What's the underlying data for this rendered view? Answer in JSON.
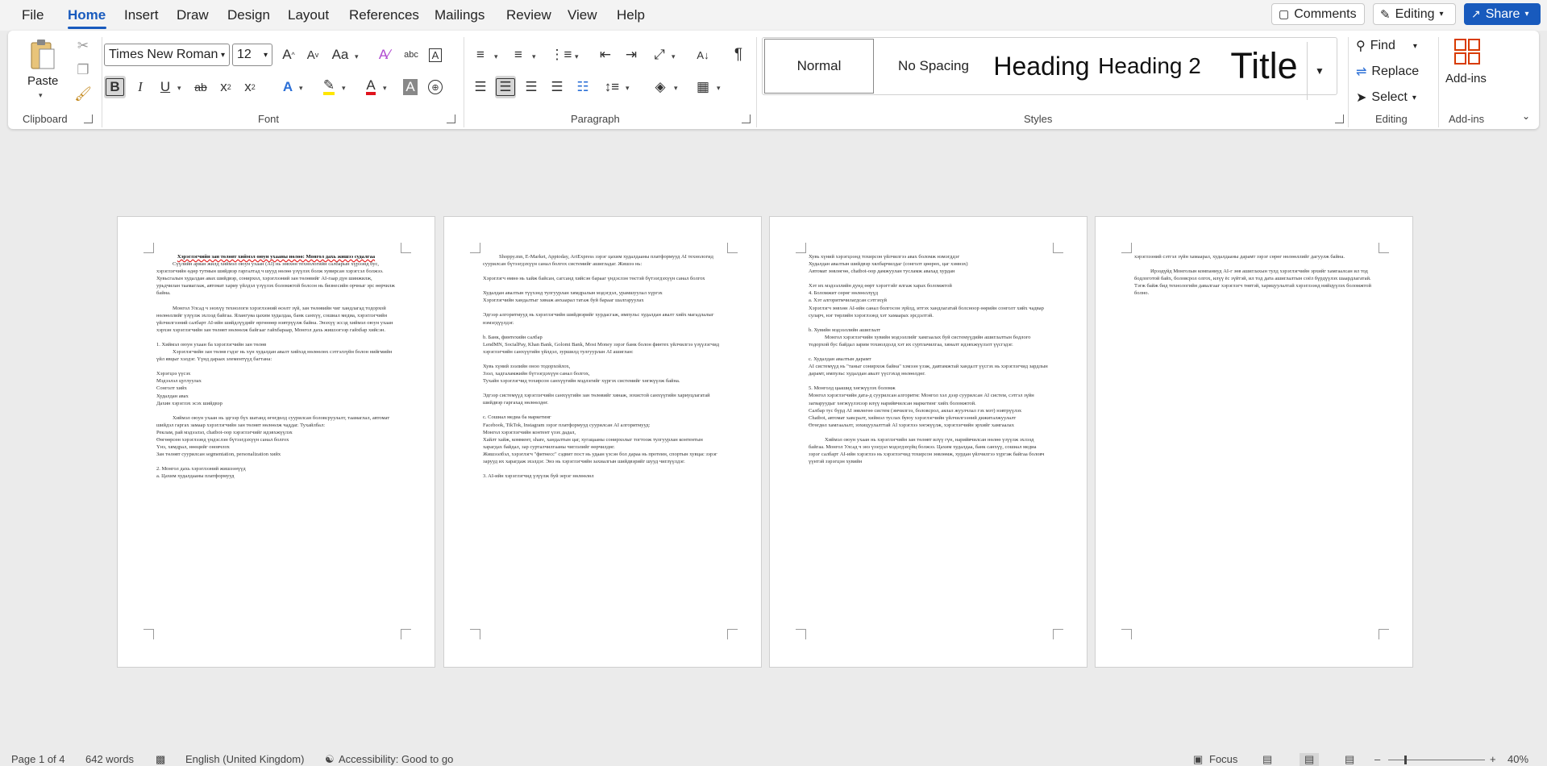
{
  "menu": {
    "items": [
      "File",
      "Home",
      "Insert",
      "Draw",
      "Design",
      "Layout",
      "References",
      "Mailings",
      "Review",
      "View",
      "Help"
    ],
    "comments": "Comments",
    "editing": "Editing",
    "share": "Share"
  },
  "ribbon": {
    "clipboard": {
      "paste": "Paste",
      "label": "Clipboard"
    },
    "font": {
      "name": "Times New Roman",
      "size": "12",
      "case": "Aa",
      "label": "Font"
    },
    "paragraph": {
      "label": "Paragraph"
    },
    "styles": {
      "items": [
        "Normal",
        "No Spacing",
        "Heading",
        "Heading 2",
        "Title"
      ],
      "label": "Styles"
    },
    "editing": {
      "find": "Find",
      "replace": "Replace",
      "select": "Select",
      "label": "Editing"
    },
    "addins": {
      "button": "Add-ins",
      "label": "Add-ins"
    }
  },
  "pages": [
    {
      "lines": [
        {
          "t": "Хэрэглэгчийн зан төлөвт хиймэл оюун ухааны нөлөө: Монгол дахь жишээ судалгаа",
          "c": "title"
        },
        {
          "t": "Сүүлийн арван жилд хиймэл оюун ухаан (AI) нь зөвхөн технологийн салбарын хүрээнд бус, хэрэглэгчийн өдөр тутмын шийдвэр гаргалтад ч шууд нөлөө үзүүлэх болж хувирсан хэрэгсэл болжээ. Хувьсгалын худалдан авах шийдвэр, сонирхол, хэрэглээний зан төлөвийг AI-гаар дүн шинжилж, урьдчилан таамаглаж, автомат хариу үйлдэл үзүүлэх боломжтой болсон нь бизнесийн орчныг эрс өөрчилж байна.",
          "c": "ind"
        },
        {
          "t": "",
          "c": "gap"
        },
        {
          "t": "Монгол Улсад ч энэхүү технологи хэрэглээний өсөлт зүй, зан төлөвийн чиг хандлагад тодорхой нөлөөллийг үзүүлж эхлээд байгаа. Ялангуяа цахим худалдаа, банк санхүү, сошиал медиа, хэрэглэгчийн үйлчилгээний салбарт AI-ийн шийдлүүдийг өргөнөөр нэвтрүүлж байна. Энэхүү эссэд хиймэл оюун ухаан хэрхэн хэрэглэгчийн зан төлөвт нөлөөлж байгааг гайхбараар, Монгол дахь жишээгээр гайхбар хийсэн.",
          "c": "ind"
        },
        {
          "t": "",
          "c": "gap"
        },
        {
          "t": "1. Хиймэл оюун ухаан ба хэрэглэгчийн зан төлөв",
          "c": ""
        },
        {
          "t": "Хэрэглэгчийн зан төлөв гэдэг нь хүн худалдан авалт хийхэд нөлөөлөх сэтгэлзүйн болон нийгмийн үйл явцыг хэлдэг. Үүнд дараах элементүүд багтана:",
          "c": "ind"
        },
        {
          "t": "",
          "c": "gap"
        },
        {
          "t": "Хэрэгцээ үүсэх",
          "c": ""
        },
        {
          "t": "Мэдээлэл цуглуулах",
          "c": ""
        },
        {
          "t": "Сонголт хийх",
          "c": ""
        },
        {
          "t": "Худалдан авах",
          "c": ""
        },
        {
          "t": "Дахин хэрэглэх эсэх шийдвэр",
          "c": ""
        },
        {
          "t": "",
          "c": "gap"
        },
        {
          "t": "Хиймэл оюун ухаан нь эдгээр бүх шатанд өгөгдөлд суурилсан боловсруулалт, таамаглал, автомат шийдэл гаргах замаар хэрэглэгчийн зан төлөвт нөлөөлж чаддаг. Тухайлбал:",
          "c": "ind"
        },
        {
          "t": "Реклам, рай мэдээлэл, chatbot-оор хэрэглэгчийг идэвхжүүлэх",
          "c": ""
        },
        {
          "t": "Өөгөөрсөн хэрэглээнд үндэслэн бүтээгдэхүүн санал болгох",
          "c": ""
        },
        {
          "t": "Үнэ, хямдрал, нөөцийг оновчлох",
          "c": ""
        },
        {
          "t": "Зан төлөвт суурилсан segmentation, personalization хийх",
          "c": ""
        },
        {
          "t": "",
          "c": "gap"
        },
        {
          "t": "2. Монгол дахь хэрэглээний жишээнүүд",
          "c": ""
        },
        {
          "t": "a. Цахим худалдааны платформууд",
          "c": ""
        }
      ]
    },
    {
      "lines": [
        {
          "t": "Shoppy.mn, E-Market, Apptoday, AriExpress зэрэг цахим худалдааны платформууд AI технологид суурилсан бүтээгдэхүүн санал болгох системийг ашигладаг. Жишээ нь:",
          "c": "ind"
        },
        {
          "t": "",
          "c": "gap"
        },
        {
          "t": "Хэрэглэгч өмнө нь хайж байсан, сагсанд хийсэн барааг үндэслэн төстэй бүтээгдэхүүн санал болгох",
          "c": ""
        },
        {
          "t": "",
          "c": "gap"
        },
        {
          "t": "Худалдан авалтын түүхэнд тулгуурлан хямдралын мэдэгдэл, урамшуулал хүргэх",
          "c": ""
        },
        {
          "t": "Хэрэглэгчийн хандалтыг хянаж анхаарал татаж буй барааг шалгаруулах",
          "c": ""
        },
        {
          "t": "",
          "c": "gap"
        },
        {
          "t": "Эдгээр алгоритмууд нь хэрэглэгчийн шийдвэрийг хурдасгаж, импульс худалдан авалт хийх магадлалыг нэмэгдүүлдэг.",
          "c": ""
        },
        {
          "t": "",
          "c": "gap"
        },
        {
          "t": "b. Банк, финтехийн салбар",
          "c": ""
        },
        {
          "t": "LendMN, SocialPay, Khan Bank, Golomt Bank, Most Money зэрэг банк болон финтех үйлчилгээ үзүүлэгчид хэрэглэгчийн санхүүгийн үйлдэл, зуршилд тулгуурлан AI ашиглан:",
          "c": ""
        },
        {
          "t": "",
          "c": "gap"
        },
        {
          "t": "Хувь хүний зээлийн оноо тодорхойлох,",
          "c": ""
        },
        {
          "t": "Зээл, хадгаламжийн бүтээгдэхүүн санал болгох,",
          "c": ""
        },
        {
          "t": "Тухайн хэрэглэгчид тохирсон санхүүгийн мэдлэгийг хүргэх системийг хөгжүүлж байна.",
          "c": ""
        },
        {
          "t": "",
          "c": "gap"
        },
        {
          "t": "Эдгээр системүүд хэрэглэгчийн санхүүгийн зан төлөвийг хянаж, зохистой санхүүгийн хариуцлагатай шийдвэр гаргахад нөлөөлдөг.",
          "c": ""
        },
        {
          "t": "",
          "c": "gap"
        },
        {
          "t": "c. Сошиал медиа ба маркетинг",
          "c": ""
        },
        {
          "t": "Facebook, TikTok, Instagram зэрэг платформууд суурилсан AI алгоритмууд:",
          "c": ""
        },
        {
          "t": "Монгол хэрэглэгчийн контент үзэх дадал,",
          "c": ""
        },
        {
          "t": "Хайлт хайж, коммент, share, хандалтын цаг, хугацааны сонирхолыг тогтоож тулгуурлан контентын харагдах байдал, зар сурталчилгааны чиглэлийг өөрчилдөг.",
          "c": ""
        },
        {
          "t": "Жишээлбэл, хэрэглэгч \"фитнесс\" сэдвит пост нь удаан үзсэн бол дараа нь протеин, спортын хувцас зэрэг зарууд их харагдаж эхэлдэг. Энэ нь хэрэглэгчийн захиалгын шийдвэрийг шууд чиглүүлдэг.",
          "c": ""
        },
        {
          "t": "",
          "c": "gap"
        },
        {
          "t": "3. AI-ийн хэрэглэгчид үзүүлж буй эерэг нөлөөлөл",
          "c": ""
        }
      ]
    },
    {
      "lines": [
        {
          "t": "Хувь хүний хэрэгцээнд тохирсон үйлчилгээ авах боломж нэмэгддэг",
          "c": ""
        },
        {
          "t": "Худалдан авалтын шийдвэр хялбарчилдаг (сонголт цөөрөх, цаг хэмнэх)",
          "c": ""
        },
        {
          "t": "Автомат зөвлөгөө, chatbot-оор дамжуулан тусламж авахад хурдан",
          "c": ""
        },
        {
          "t": "",
          "c": "gap"
        },
        {
          "t": "Хэт их мэдээллийн дунд өөрт хэрэгтэйг ялгаж харах боломжтой",
          "c": ""
        },
        {
          "t": "4. Боломжит сөрөг нөлөөллүүд",
          "c": ""
        },
        {
          "t": "a. Хэт алгоритмчилагдсан сэтгэхүй",
          "c": ""
        },
        {
          "t": "Хэрэглэгч зөвхөн AI-ийн санал болгосон зүйлд, итгэх хандлагатай болсноор өөрийн сонголт хийх чадвар суларч, нэг төрлийн хэрэглээнд хэт хамаарах эрсдэлтэй.",
          "c": ""
        },
        {
          "t": "",
          "c": "gap"
        },
        {
          "t": "b. Хувийн мэдээллийн ашиглалт",
          "c": ""
        },
        {
          "t": "Монгол хэрэглэгчийн хувийн мэдээллийг хамгаалах буй системүүдийн ашиглалтын бодлого тодорхой бус байдал зарим тохиолдолд хэт их суртлачилгаа, хяналт идэвхжүүлэлт үүсгэдэг.",
          "c": "ind"
        },
        {
          "t": "",
          "c": "gap"
        },
        {
          "t": "c. Худалдан авалтын дарамт",
          "c": ""
        },
        {
          "t": "AI системүүд нь \"таныг сонирхож байна\" хэмээн үзэж, давтамжтай хандалт үүсгэх нь хэрэглэгчид зардлын дарамт, импульс худалдан авалт үүсгэхэд нөлөөлдөг.",
          "c": ""
        },
        {
          "t": "",
          "c": "gap"
        },
        {
          "t": "5. Монголд цаашид хөгжүүлэх боломж",
          "c": ""
        },
        {
          "t": "Монгол хэрэглэгчийн дата-д суурилсан алгоритм: Монгол хэл дээр суурилсан AI систем, сэтгэл зүйн загваруудыг хөгжүүлэхээр илүү нарийвчилсан маркетинг хийх боломжтой.",
          "c": ""
        },
        {
          "t": "Салбар тус бүрд AI зөвлөгөө систем (эмчилгээ, боловсрол, аялал жуулчлал гэх мэт) нэвтрүүлэх",
          "c": ""
        },
        {
          "t": "Chatbot, автомат хавсралт, хиймэл туслах буюу хэрэглэгчийн үйлчилгээний дижиталжуулалт",
          "c": ""
        },
        {
          "t": "Өгөгдөл хамгаалалт, зохицуулалттай AI хэрэглээ хөгжүүлж, хэрэглэгчийн эрхийг хамгаалах",
          "c": ""
        },
        {
          "t": "",
          "c": "gap"
        },
        {
          "t": "Хиймэл оюун ухаан нь хэрэглэгчийн зан төлөвт илүү гүн, нарийвчилсан нөлөө үзүүлж эхлээд байгаа. Монгол Улсад ч энэ үзэгдэл мэдэгдэхүйц болжээ. Цахим худалдаа, банк санхүү, сошиал медиа зэрэг салбарт AI-ийн хэрэглээ нь хэрэглэгчид тохирсон зөвлөмж, хурдан үйлчилгээ хүргэж байгаа боловч үүнтэй зэрэгцэн хувийн",
          "c": "ind"
        }
      ]
    },
    {
      "lines": [
        {
          "t": "хэрэглээний сэтгэл зүйн хамаарал, худалдааны дарамт зэрэг сөрөг нөлөөллийг дагуулж байна.",
          "c": ""
        },
        {
          "t": "",
          "c": "gap"
        },
        {
          "t": "Ирээдүйд Монголын компаниуд AI-г зөв ашиглахын тулд хэрэглэгчийн эрхийг хамгаалсан ил тод бодлоготой байх, боловсрол олгох, илүү ёс зүйтэй, ил тод дата ашиглалтын соёл бүрдүүлэх шаардлагатай. Тэгж байж бид технологийн давалгааг хэрэглэгч төвтэй, харицуулалтай хэрэглээнд нийцүүлэх боломжтой болно.",
          "c": "ind"
        }
      ]
    }
  ],
  "status": {
    "page": "Page 1 of 4",
    "words": "642 words",
    "language": "English (United Kingdom)",
    "accessibility": "Accessibility: Good to go",
    "focus": "Focus",
    "zoom": "40%"
  }
}
